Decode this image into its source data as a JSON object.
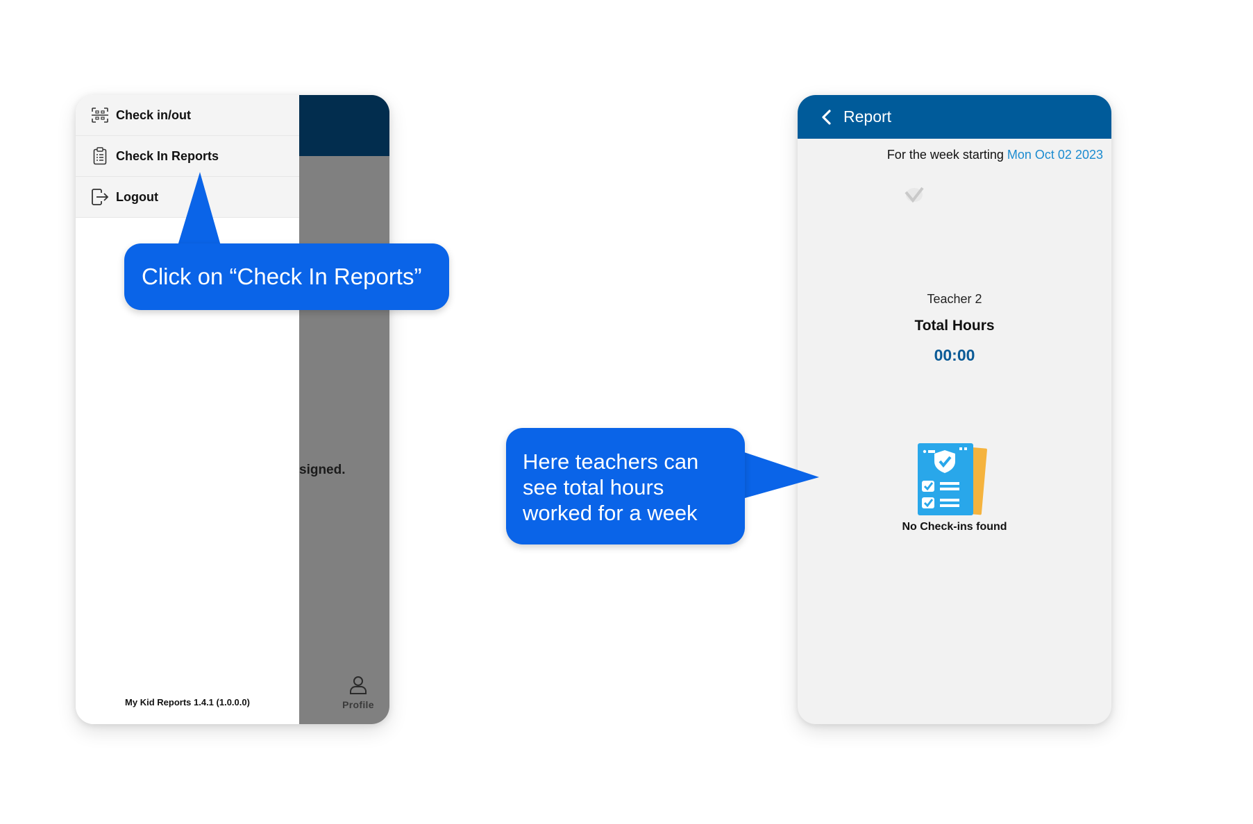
{
  "left_screen": {
    "menu": [
      {
        "label": "Check in/out",
        "icon": "scan-icon"
      },
      {
        "label": "Check In Reports",
        "icon": "clipboard-icon"
      },
      {
        "label": "Logout",
        "icon": "logout-icon"
      }
    ],
    "version": "My Kid Reports 1.4.1 (1.0.0.0)",
    "background": {
      "partial_text": "signed.",
      "profile_label": "Profile"
    }
  },
  "right_screen": {
    "header_title": "Report",
    "week_prefix": "For the week starting",
    "week_date": "Mon Oct 02 2023",
    "teacher_name": "Teacher 2",
    "total_hours_label": "Total Hours",
    "total_hours_value": "00:00",
    "empty_message": "No Check-ins found"
  },
  "callouts": {
    "step1": "Click on “Check In Reports”",
    "step2": "Here teachers can see total hours worked for a week"
  },
  "colors": {
    "header_dark": "#022d4e",
    "header_blue": "#005b9a",
    "callout_blue": "#0a64e8",
    "date_link": "#1b8bd0",
    "hours_value": "#0a5a96"
  }
}
